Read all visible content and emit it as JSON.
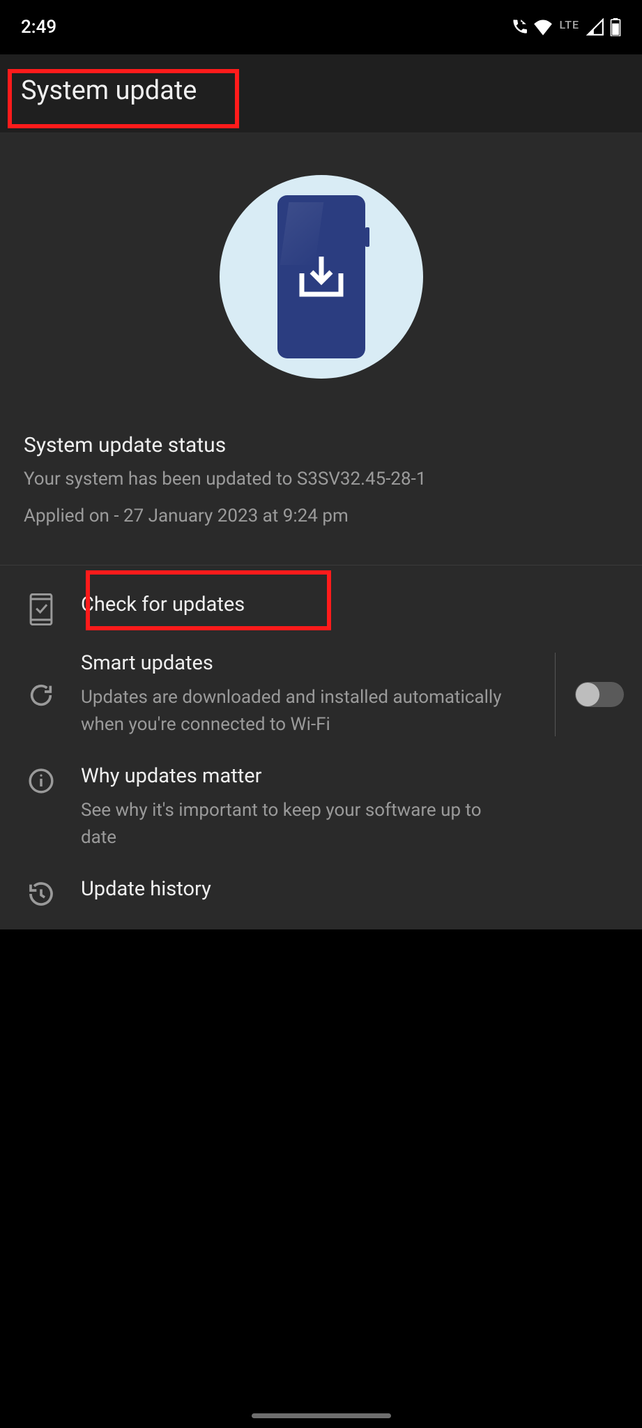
{
  "status_bar": {
    "time": "2:49",
    "network_label": "LTE"
  },
  "header": {
    "title": "System update"
  },
  "hero": {
    "status_title": "System update status",
    "status_line1": "Your system has been updated to S3SV32.45-28-1",
    "status_line2": "Applied on - 27 January 2023 at 9:24 pm"
  },
  "list": {
    "check": {
      "title": "Check for updates"
    },
    "smart": {
      "title": "Smart updates",
      "subtitle": "Updates are downloaded and installed automatically when you're connected to Wi-Fi",
      "toggle_on": false
    },
    "why": {
      "title": "Why updates matter",
      "subtitle": "See why it's important to keep your software up to date"
    },
    "history": {
      "title": "Update history"
    }
  }
}
